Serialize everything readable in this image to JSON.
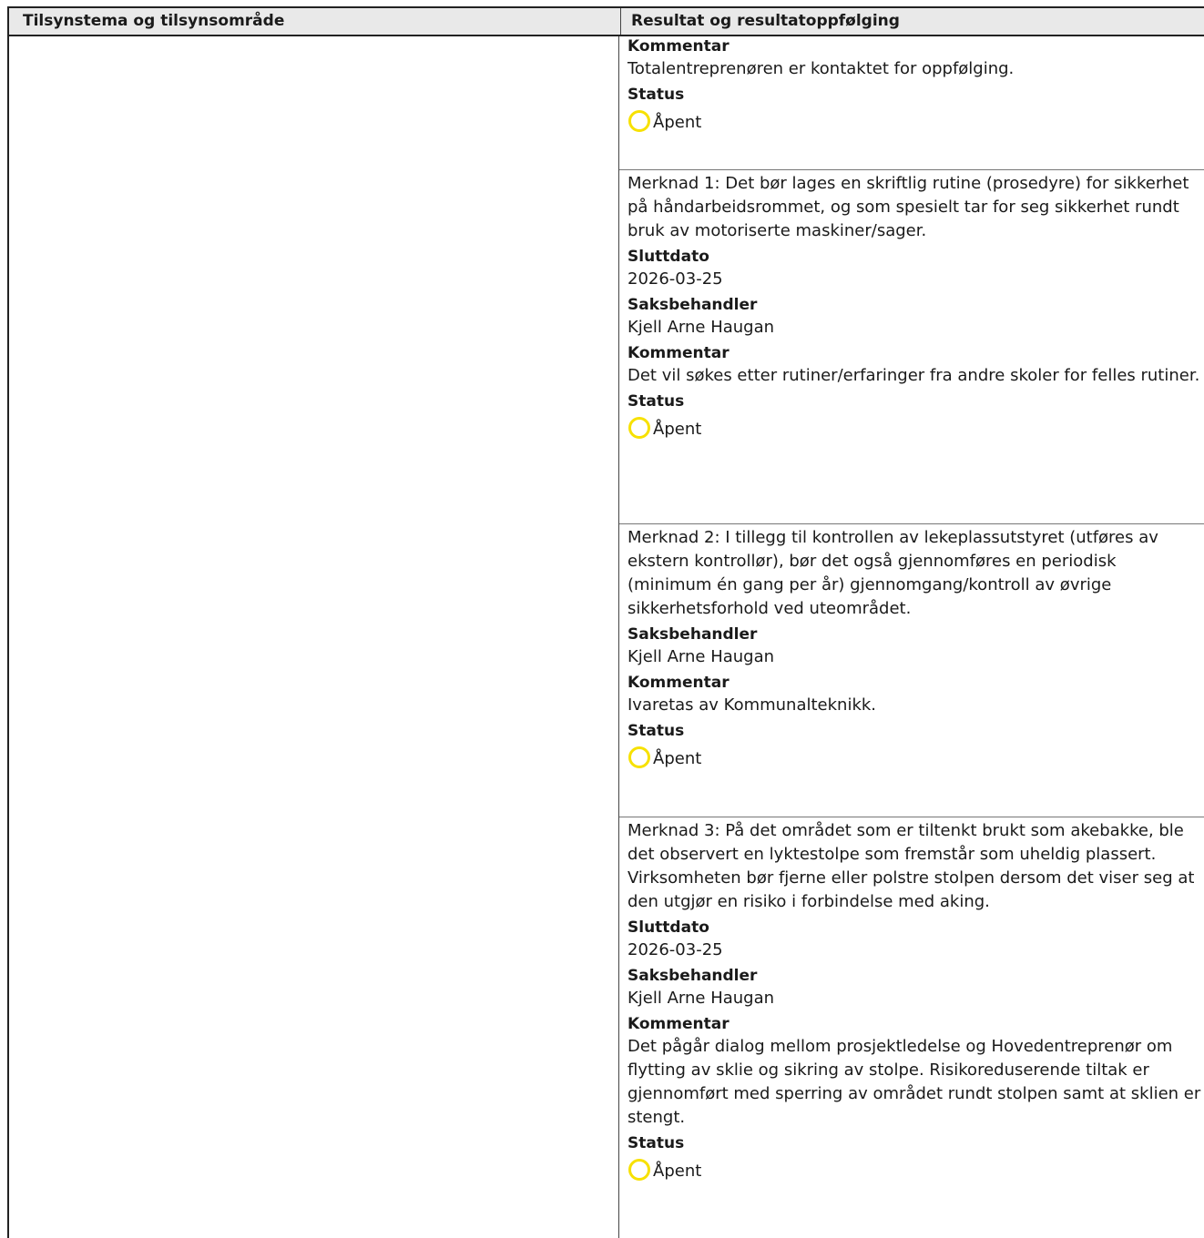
{
  "header": {
    "col_left": "Tilsynstema og tilsynsområde",
    "col_right": "Resultat og resultatoppfølging"
  },
  "colors": {
    "status_open": "#f7e100",
    "border": "#222222",
    "header_bg": "#e9e9e9"
  },
  "blocks": [
    {
      "kommentar_label": "Kommentar",
      "kommentar": "Totalentreprenøren er kontaktet for oppfølging.",
      "status_label": "Status",
      "status": "Åpent"
    },
    {
      "note": "Merknad 1: Det bør lages en skriftlig rutine (prosedyre) for sikkerhet på håndarbeidsrommet, og som spesielt tar for seg sikkerhet rundt bruk av motoriserte maskiner/sager.",
      "sluttdato_label": "Sluttdato",
      "sluttdato": "2026-03-25",
      "saksbehandler_label": "Saksbehandler",
      "saksbehandler": "Kjell Arne Haugan",
      "kommentar_label": "Kommentar",
      "kommentar": "Det vil søkes etter rutiner/erfaringer fra andre skoler for felles rutiner.",
      "status_label": "Status",
      "status": "Åpent"
    },
    {
      "note": "Merknad 2: I tillegg til kontrollen av lekeplassutstyret (utføres av ekstern kontrollør), bør det også gjennomføres en periodisk (minimum én gang per år) gjennomgang/kontroll av øvrige sikkerhetsforhold ved uteområdet.",
      "saksbehandler_label": "Saksbehandler",
      "saksbehandler": "Kjell Arne Haugan",
      "kommentar_label": "Kommentar",
      "kommentar": "Ivaretas av Kommunalteknikk.",
      "status_label": "Status",
      "status": "Åpent"
    },
    {
      "note": "Merknad 3: På det området som er tiltenkt brukt som akebakke, ble det observert en lyktestolpe som fremstår som uheldig plassert. Virksomheten bør fjerne eller polstre stolpen dersom det viser seg at den utgjør en risiko i forbindelse med aking.",
      "sluttdato_label": "Sluttdato",
      "sluttdato": "2026-03-25",
      "saksbehandler_label": "Saksbehandler",
      "saksbehandler": "Kjell Arne Haugan",
      "kommentar_label": "Kommentar",
      "kommentar": "Det pågår dialog mellom prosjektledelse og Hovedentreprenør om flytting av sklie og sikring av stolpe. Risikoreduserende tiltak er gjennomført med sperring av området rundt stolpen samt at sklien er stengt.",
      "status_label": "Status",
      "status": "Åpent"
    }
  ]
}
